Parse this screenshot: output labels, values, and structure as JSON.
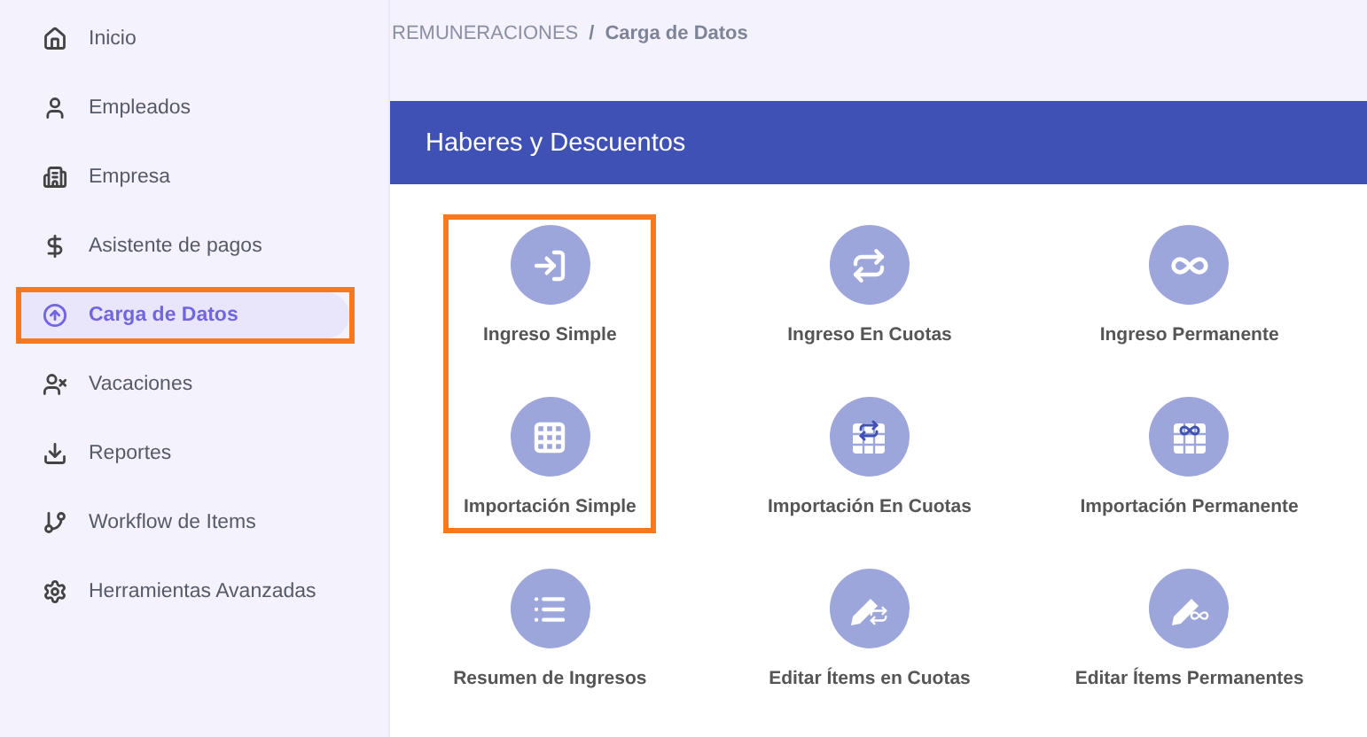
{
  "sidebar": {
    "items": [
      {
        "label": "Inicio",
        "selected": false,
        "highlighted": false
      },
      {
        "label": "Empleados",
        "selected": false,
        "highlighted": false
      },
      {
        "label": "Empresa",
        "selected": false,
        "highlighted": false
      },
      {
        "label": "Asistente de pagos",
        "selected": false,
        "highlighted": false
      },
      {
        "label": "Carga de Datos",
        "selected": true,
        "highlighted": true
      },
      {
        "label": "Vacaciones",
        "selected": false,
        "highlighted": false
      },
      {
        "label": "Reportes",
        "selected": false,
        "highlighted": false
      },
      {
        "label": "Workflow de Items",
        "selected": false,
        "highlighted": false
      },
      {
        "label": "Herramientas Avanzadas",
        "selected": false,
        "highlighted": false
      }
    ]
  },
  "breadcrumb": {
    "parent": "REMUNERACIONES",
    "separator": "/",
    "current": "Carga de Datos"
  },
  "panel": {
    "title": "Haberes y Descuentos",
    "actions": [
      {
        "label": "Ingreso Simple",
        "highlighted": true
      },
      {
        "label": "Ingreso En Cuotas",
        "highlighted": false
      },
      {
        "label": "Ingreso Permanente",
        "highlighted": false
      },
      {
        "label": "Importación Simple",
        "highlighted": true
      },
      {
        "label": "Importación En Cuotas",
        "highlighted": false
      },
      {
        "label": "Importación Permanente",
        "highlighted": false
      },
      {
        "label": "Resumen de Ingresos",
        "highlighted": false
      },
      {
        "label": "Editar Ítems en Cuotas",
        "highlighted": false
      },
      {
        "label": "Editar Ítems Permanentes",
        "highlighted": false
      }
    ]
  }
}
